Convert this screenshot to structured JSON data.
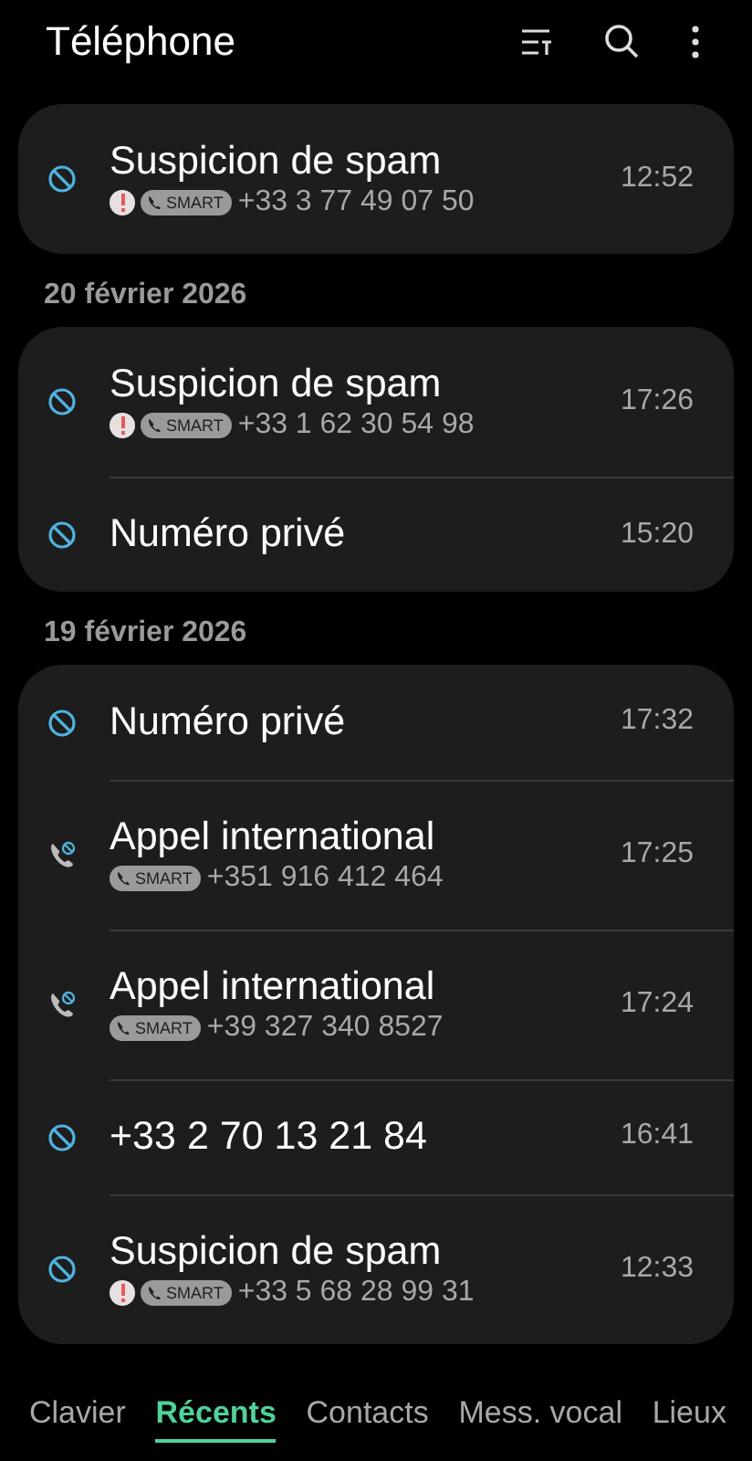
{
  "app_bar": {
    "title": "Téléphone"
  },
  "groups": [
    {
      "calls": [
        {
          "kind": "blocked",
          "name": "Suspicion de spam",
          "warning": true,
          "badge": "SMART",
          "number": "+33 3 77 49 07 50",
          "time": "12:52"
        }
      ]
    },
    {
      "date": "20 février 2026",
      "calls": [
        {
          "kind": "blocked",
          "name": "Suspicion de spam",
          "warning": true,
          "badge": "SMART",
          "number": "+33 1 62 30 54 98",
          "time": "17:26"
        },
        {
          "kind": "blocked",
          "name": "Numéro privé",
          "time": "15:20"
        }
      ]
    },
    {
      "date": "19 février 2026",
      "calls": [
        {
          "kind": "blocked",
          "name": "Numéro privé",
          "time": "17:32"
        },
        {
          "kind": "international",
          "name": "Appel international",
          "warning": false,
          "badge": "SMART",
          "number": "+351 916 412 464",
          "time": "17:25"
        },
        {
          "kind": "international",
          "name": "Appel international",
          "warning": false,
          "badge": "SMART",
          "number": "+39 327 340 8527",
          "time": "17:24"
        },
        {
          "kind": "blocked",
          "name": "+33 2 70 13 21 84",
          "time": "16:41"
        },
        {
          "kind": "blocked",
          "name": "Suspicion de spam",
          "warning": true,
          "badge": "SMART",
          "number": "+33 5 68 28 99 31",
          "time": "12:33"
        }
      ]
    }
  ],
  "tabs": [
    {
      "label": "Clavier",
      "selected": false
    },
    {
      "label": "Récents",
      "selected": true
    },
    {
      "label": "Contacts",
      "selected": false
    },
    {
      "label": "Mess. vocal",
      "selected": false
    },
    {
      "label": "Lieux",
      "selected": false
    }
  ]
}
